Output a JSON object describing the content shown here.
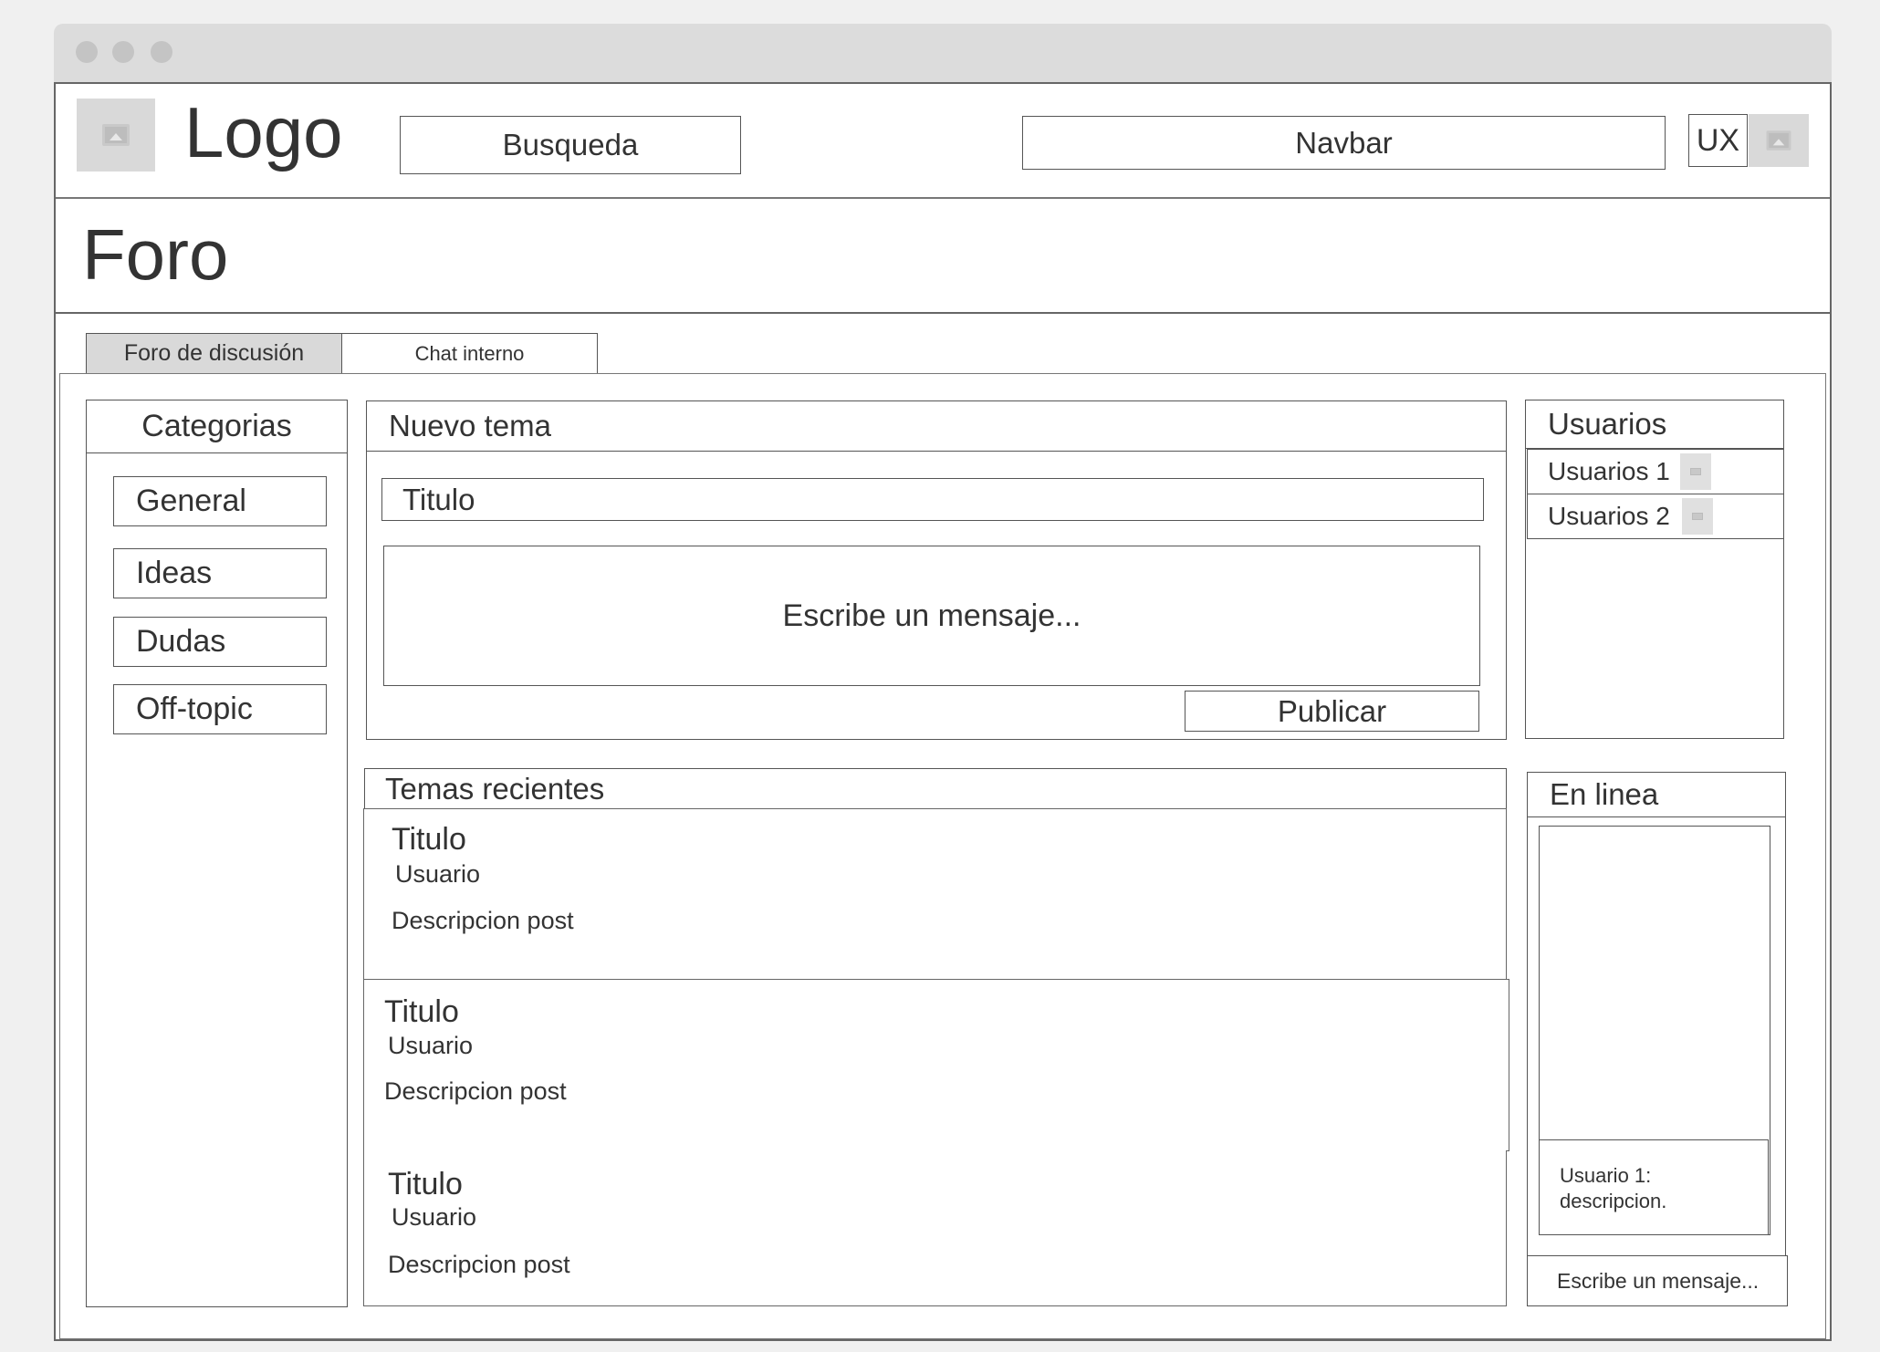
{
  "header": {
    "logo_text": "Logo",
    "search_label": "Busqueda",
    "navbar_label": "Navbar",
    "ux_label": "UX"
  },
  "page": {
    "title": "Foro"
  },
  "tabs": [
    {
      "label": "Foro de discusión",
      "active": true
    },
    {
      "label": "Chat interno",
      "active": false
    }
  ],
  "categories": {
    "title": "Categorias",
    "items": [
      "General",
      "Ideas",
      "Dudas",
      "Off-topic"
    ]
  },
  "new_topic": {
    "title": "Nuevo tema",
    "title_field": "Titulo",
    "message_placeholder": "Escribe un mensaje...",
    "publish_label": "Publicar"
  },
  "recent": {
    "title": "Temas recientes",
    "posts": [
      {
        "title": "Titulo",
        "user": "Usuario",
        "description": "Descripcion post"
      },
      {
        "title": "Titulo",
        "user": "Usuario",
        "description": "Descripcion post"
      },
      {
        "title": "Titulo",
        "user": "Usuario",
        "description": "Descripcion post"
      }
    ]
  },
  "users": {
    "title": "Usuarios",
    "items": [
      "Usuarios 1",
      "Usuarios 2"
    ]
  },
  "online": {
    "title": "En linea",
    "chat_message_line1": "Usuario 1:",
    "chat_message_line2": "descripcion.",
    "input_placeholder": "Escribe un mensaje..."
  },
  "colors": {
    "tab_active_bg": "#d9d9d9",
    "chrome": "#dcdcdc",
    "border": "#555555"
  }
}
